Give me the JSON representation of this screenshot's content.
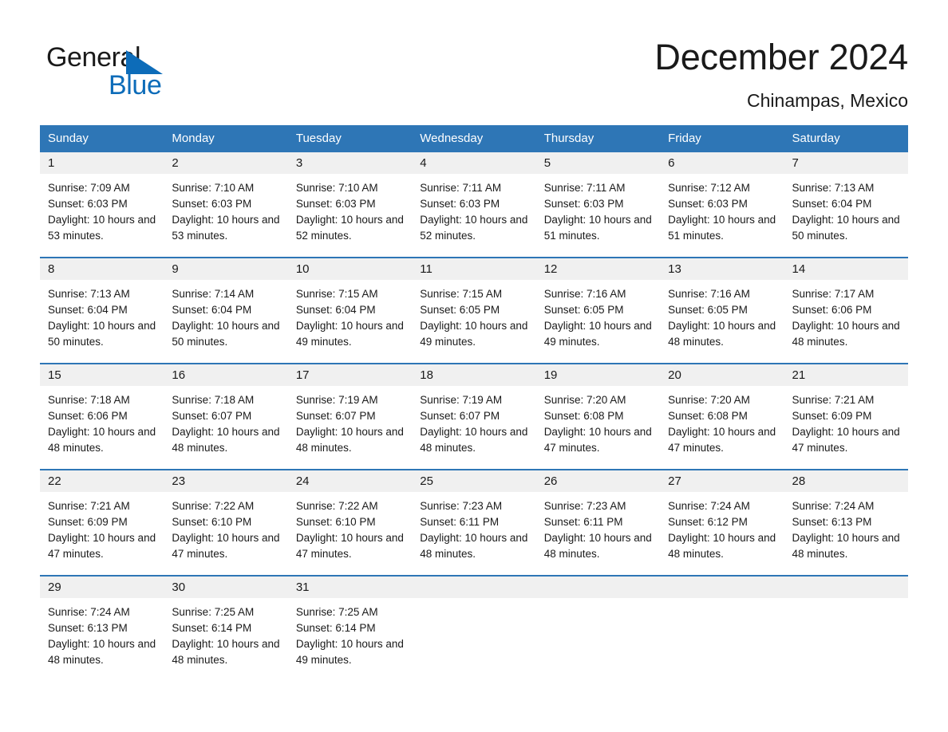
{
  "brand": {
    "name_part1": "General",
    "name_part2": "Blue",
    "accent_color": "#0d6cb9"
  },
  "header": {
    "month_title": "December 2024",
    "location": "Chinampas, Mexico"
  },
  "theme": {
    "header_blue": "#2e76b6",
    "daynum_band": "#f0f0f0",
    "text": "#1a1a1a"
  },
  "weekday_headers": [
    "Sunday",
    "Monday",
    "Tuesday",
    "Wednesday",
    "Thursday",
    "Friday",
    "Saturday"
  ],
  "weeks": [
    [
      {
        "day": "1",
        "sunrise": "Sunrise: 7:09 AM",
        "sunset": "Sunset: 6:03 PM",
        "daylight": "Daylight: 10 hours and 53 minutes."
      },
      {
        "day": "2",
        "sunrise": "Sunrise: 7:10 AM",
        "sunset": "Sunset: 6:03 PM",
        "daylight": "Daylight: 10 hours and 53 minutes."
      },
      {
        "day": "3",
        "sunrise": "Sunrise: 7:10 AM",
        "sunset": "Sunset: 6:03 PM",
        "daylight": "Daylight: 10 hours and 52 minutes."
      },
      {
        "day": "4",
        "sunrise": "Sunrise: 7:11 AM",
        "sunset": "Sunset: 6:03 PM",
        "daylight": "Daylight: 10 hours and 52 minutes."
      },
      {
        "day": "5",
        "sunrise": "Sunrise: 7:11 AM",
        "sunset": "Sunset: 6:03 PM",
        "daylight": "Daylight: 10 hours and 51 minutes."
      },
      {
        "day": "6",
        "sunrise": "Sunrise: 7:12 AM",
        "sunset": "Sunset: 6:03 PM",
        "daylight": "Daylight: 10 hours and 51 minutes."
      },
      {
        "day": "7",
        "sunrise": "Sunrise: 7:13 AM",
        "sunset": "Sunset: 6:04 PM",
        "daylight": "Daylight: 10 hours and 50 minutes."
      }
    ],
    [
      {
        "day": "8",
        "sunrise": "Sunrise: 7:13 AM",
        "sunset": "Sunset: 6:04 PM",
        "daylight": "Daylight: 10 hours and 50 minutes."
      },
      {
        "day": "9",
        "sunrise": "Sunrise: 7:14 AM",
        "sunset": "Sunset: 6:04 PM",
        "daylight": "Daylight: 10 hours and 50 minutes."
      },
      {
        "day": "10",
        "sunrise": "Sunrise: 7:15 AM",
        "sunset": "Sunset: 6:04 PM",
        "daylight": "Daylight: 10 hours and 49 minutes."
      },
      {
        "day": "11",
        "sunrise": "Sunrise: 7:15 AM",
        "sunset": "Sunset: 6:05 PM",
        "daylight": "Daylight: 10 hours and 49 minutes."
      },
      {
        "day": "12",
        "sunrise": "Sunrise: 7:16 AM",
        "sunset": "Sunset: 6:05 PM",
        "daylight": "Daylight: 10 hours and 49 minutes."
      },
      {
        "day": "13",
        "sunrise": "Sunrise: 7:16 AM",
        "sunset": "Sunset: 6:05 PM",
        "daylight": "Daylight: 10 hours and 48 minutes."
      },
      {
        "day": "14",
        "sunrise": "Sunrise: 7:17 AM",
        "sunset": "Sunset: 6:06 PM",
        "daylight": "Daylight: 10 hours and 48 minutes."
      }
    ],
    [
      {
        "day": "15",
        "sunrise": "Sunrise: 7:18 AM",
        "sunset": "Sunset: 6:06 PM",
        "daylight": "Daylight: 10 hours and 48 minutes."
      },
      {
        "day": "16",
        "sunrise": "Sunrise: 7:18 AM",
        "sunset": "Sunset: 6:07 PM",
        "daylight": "Daylight: 10 hours and 48 minutes."
      },
      {
        "day": "17",
        "sunrise": "Sunrise: 7:19 AM",
        "sunset": "Sunset: 6:07 PM",
        "daylight": "Daylight: 10 hours and 48 minutes."
      },
      {
        "day": "18",
        "sunrise": "Sunrise: 7:19 AM",
        "sunset": "Sunset: 6:07 PM",
        "daylight": "Daylight: 10 hours and 48 minutes."
      },
      {
        "day": "19",
        "sunrise": "Sunrise: 7:20 AM",
        "sunset": "Sunset: 6:08 PM",
        "daylight": "Daylight: 10 hours and 47 minutes."
      },
      {
        "day": "20",
        "sunrise": "Sunrise: 7:20 AM",
        "sunset": "Sunset: 6:08 PM",
        "daylight": "Daylight: 10 hours and 47 minutes."
      },
      {
        "day": "21",
        "sunrise": "Sunrise: 7:21 AM",
        "sunset": "Sunset: 6:09 PM",
        "daylight": "Daylight: 10 hours and 47 minutes."
      }
    ],
    [
      {
        "day": "22",
        "sunrise": "Sunrise: 7:21 AM",
        "sunset": "Sunset: 6:09 PM",
        "daylight": "Daylight: 10 hours and 47 minutes."
      },
      {
        "day": "23",
        "sunrise": "Sunrise: 7:22 AM",
        "sunset": "Sunset: 6:10 PM",
        "daylight": "Daylight: 10 hours and 47 minutes."
      },
      {
        "day": "24",
        "sunrise": "Sunrise: 7:22 AM",
        "sunset": "Sunset: 6:10 PM",
        "daylight": "Daylight: 10 hours and 47 minutes."
      },
      {
        "day": "25",
        "sunrise": "Sunrise: 7:23 AM",
        "sunset": "Sunset: 6:11 PM",
        "daylight": "Daylight: 10 hours and 48 minutes."
      },
      {
        "day": "26",
        "sunrise": "Sunrise: 7:23 AM",
        "sunset": "Sunset: 6:11 PM",
        "daylight": "Daylight: 10 hours and 48 minutes."
      },
      {
        "day": "27",
        "sunrise": "Sunrise: 7:24 AM",
        "sunset": "Sunset: 6:12 PM",
        "daylight": "Daylight: 10 hours and 48 minutes."
      },
      {
        "day": "28",
        "sunrise": "Sunrise: 7:24 AM",
        "sunset": "Sunset: 6:13 PM",
        "daylight": "Daylight: 10 hours and 48 minutes."
      }
    ],
    [
      {
        "day": "29",
        "sunrise": "Sunrise: 7:24 AM",
        "sunset": "Sunset: 6:13 PM",
        "daylight": "Daylight: 10 hours and 48 minutes."
      },
      {
        "day": "30",
        "sunrise": "Sunrise: 7:25 AM",
        "sunset": "Sunset: 6:14 PM",
        "daylight": "Daylight: 10 hours and 48 minutes."
      },
      {
        "day": "31",
        "sunrise": "Sunrise: 7:25 AM",
        "sunset": "Sunset: 6:14 PM",
        "daylight": "Daylight: 10 hours and 49 minutes."
      },
      {
        "day": "",
        "sunrise": "",
        "sunset": "",
        "daylight": ""
      },
      {
        "day": "",
        "sunrise": "",
        "sunset": "",
        "daylight": ""
      },
      {
        "day": "",
        "sunrise": "",
        "sunset": "",
        "daylight": ""
      },
      {
        "day": "",
        "sunrise": "",
        "sunset": "",
        "daylight": ""
      }
    ]
  ]
}
